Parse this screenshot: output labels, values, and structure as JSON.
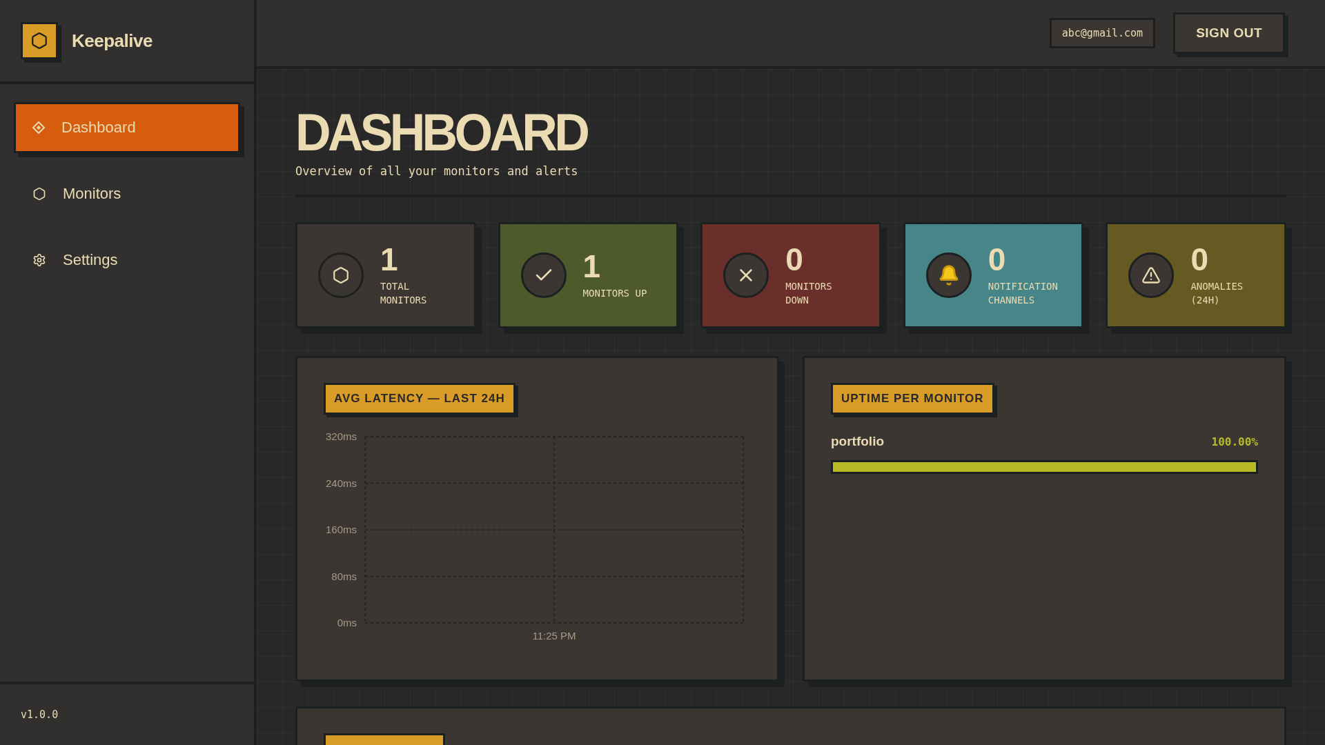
{
  "app": {
    "name": "Keepalive",
    "version": "v1.0.0"
  },
  "nav": [
    {
      "label": "Dashboard",
      "kind": "dashboard",
      "selected": true
    },
    {
      "label": "Monitors",
      "kind": "monitors",
      "selected": false
    },
    {
      "label": "Settings",
      "kind": "settings",
      "selected": false
    }
  ],
  "header": {
    "email": "abc@gmail.com",
    "sign_out": "SIGN OUT"
  },
  "page": {
    "title": "DASHBOARD",
    "subtitle": "Overview of all your monitors and alerts"
  },
  "stats": [
    {
      "kind": "total",
      "value": "1",
      "label": "TOTAL MONITORS",
      "color": "#3c3633"
    },
    {
      "kind": "up",
      "value": "1",
      "label": "MONITORS UP",
      "color": "#4e5a2b"
    },
    {
      "kind": "down",
      "value": "0",
      "label": "MONITORS DOWN",
      "color": "#6a2e2b"
    },
    {
      "kind": "channels",
      "value": "0",
      "label": "NOTIFICATION CHANNELS",
      "color": "#468688"
    },
    {
      "kind": "anomalies",
      "value": "0",
      "label": "ANOMALIES (24H)",
      "color": "#645a22"
    }
  ],
  "latency": {
    "title": "AVG LATENCY — LAST 24H",
    "chart_data": {
      "type": "line",
      "grid": true,
      "categories": [
        "11:25 PM"
      ],
      "ylim": [
        0,
        320
      ],
      "yticks": [
        {
          "value": 0,
          "label": "0ms"
        },
        {
          "value": 80,
          "label": "80ms"
        },
        {
          "value": 160,
          "label": "160ms"
        },
        {
          "value": 240,
          "label": "240ms"
        },
        {
          "value": 320,
          "label": "320ms"
        }
      ]
    }
  },
  "uptime": {
    "title": "UPTIME PER MONITOR",
    "monitors": [
      {
        "name": "portfolio",
        "reading": "100.00%",
        "level": 1.0
      }
    ]
  }
}
